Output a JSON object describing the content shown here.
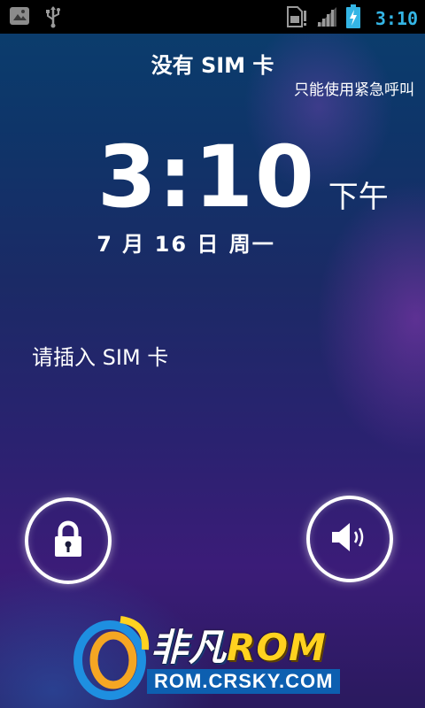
{
  "status_bar": {
    "time": "3:10",
    "accent_color": "#34b5e5",
    "left_icons": [
      "image-notification-icon",
      "usb-icon"
    ],
    "right_icons": [
      "no-sim-icon",
      "signal-icon",
      "battery-charging-icon"
    ]
  },
  "lockscreen": {
    "carrier": "没有 SIM 卡",
    "emergency_text": "只能使用紧急呼叫",
    "clock": "3:10",
    "ampm": "下午",
    "date": "7 月 16 日 周一",
    "status_message": "请插入 SIM 卡",
    "buttons": {
      "left_icon": "lock-icon",
      "right_icon": "sound-on-icon"
    }
  },
  "watermark": {
    "name": "非凡",
    "rom": "ROM",
    "url": "ROM.CRSKY.COM"
  }
}
